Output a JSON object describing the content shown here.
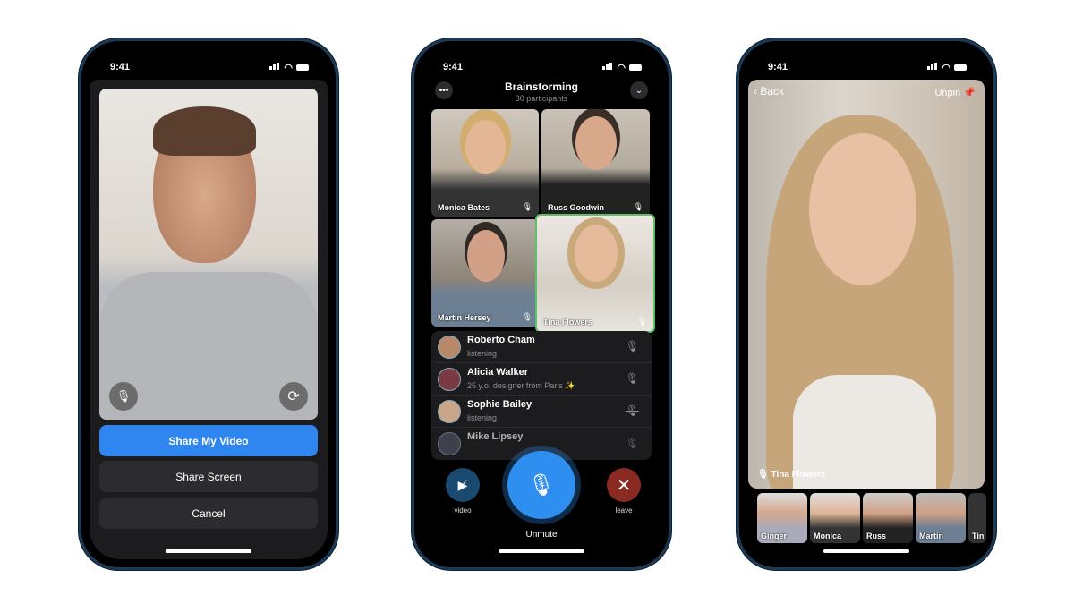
{
  "status_time": "9:41",
  "phone1": {
    "buttons": {
      "share_video": "Share My Video",
      "share_screen": "Share Screen",
      "cancel": "Cancel"
    },
    "accent": "#2f86f0"
  },
  "phone2": {
    "title": "Brainstorming",
    "subtitle": "30 participants",
    "tiles": [
      {
        "name": "Monica Bates"
      },
      {
        "name": "Russ Goodwin"
      },
      {
        "name": "Martin Hersey"
      },
      {
        "name": "Tina Flowers",
        "speaking": true
      }
    ],
    "participants": [
      {
        "name": "Roberto Cham",
        "status": "listening",
        "mic": "mic"
      },
      {
        "name": "Alicia Walker",
        "status": "25 y.o. designer from Paris ✨",
        "mic": "mic"
      },
      {
        "name": "Sophie Bailey",
        "status": "listening",
        "mic": "mic-muted"
      },
      {
        "name": "Mike Lipsey",
        "status": "",
        "mic": "mic"
      }
    ],
    "controls": {
      "video": "video",
      "unmute": "Unmute",
      "leave": "leave"
    },
    "colors": {
      "unmute": "#2f8ff0",
      "leave": "#8a2a22",
      "video": "#1b4a70",
      "speaking": "#5fbf6a"
    }
  },
  "phone3": {
    "back": "Back",
    "unpin": "Unpin",
    "speaker": "Tina Flowers",
    "thumbnails": [
      {
        "name": "Ginger"
      },
      {
        "name": "Monica"
      },
      {
        "name": "Russ"
      },
      {
        "name": "Martin"
      },
      {
        "name": "Tin"
      }
    ]
  }
}
